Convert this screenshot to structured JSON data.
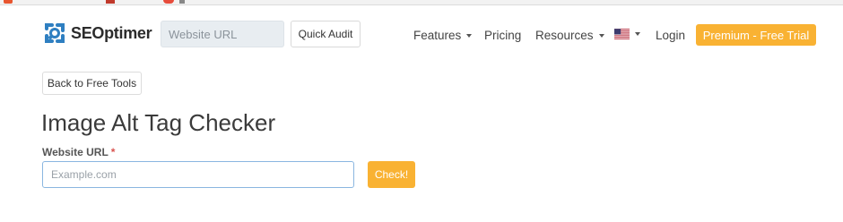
{
  "brand": {
    "name": "SEOptimer",
    "accent_color": "#f9b233",
    "logo_color": "#2f7fc1"
  },
  "navbar": {
    "url_placeholder": "Website URL",
    "quick_audit_label": "Quick Audit",
    "links": [
      {
        "label": "Features",
        "has_dropdown": true
      },
      {
        "label": "Pricing",
        "has_dropdown": false
      },
      {
        "label": "Resources",
        "has_dropdown": true
      }
    ],
    "language_icon": "us-flag-icon",
    "login_label": "Login",
    "premium_label": "Premium - Free Trial"
  },
  "main": {
    "back_label": "Back to Free Tools",
    "title": "Image Alt Tag Checker",
    "url_field_label": "Website URL",
    "required_mark": "*",
    "url_placeholder": "Example.com",
    "url_value": "",
    "check_label": "Check!"
  }
}
